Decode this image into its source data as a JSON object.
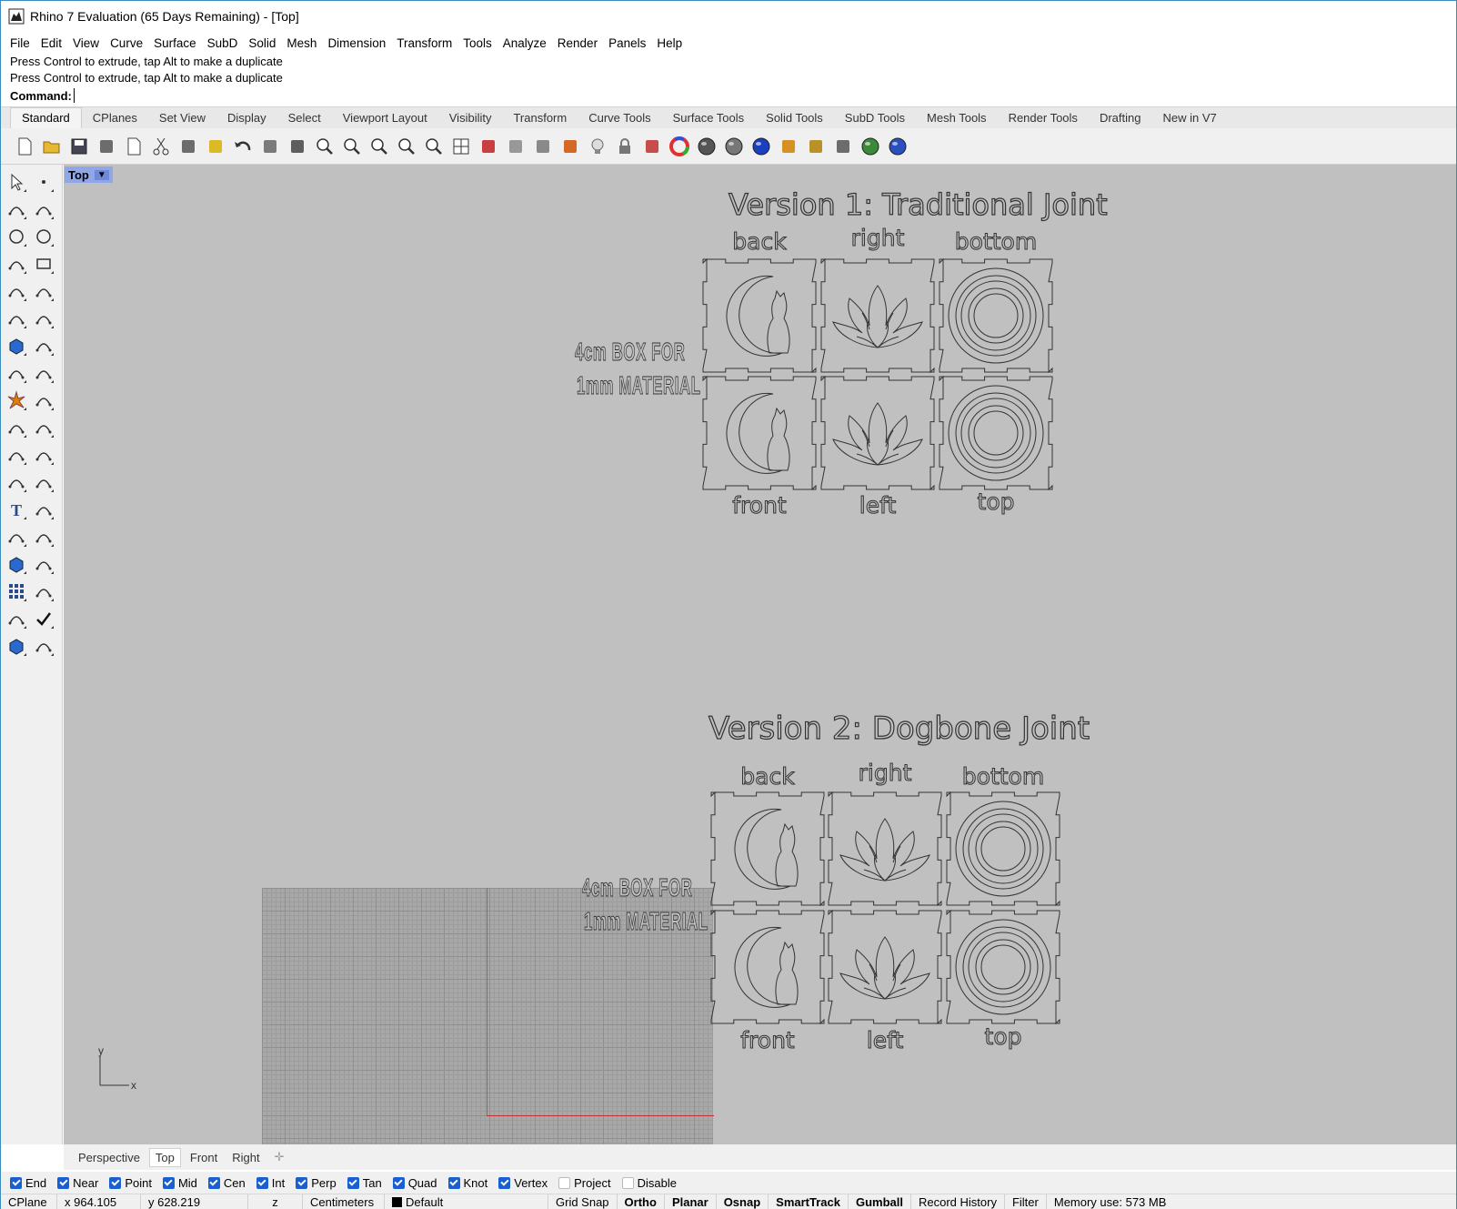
{
  "window": {
    "title": "Rhino 7 Evaluation (65 Days Remaining) - [Top]"
  },
  "menu": [
    "File",
    "Edit",
    "View",
    "Curve",
    "Surface",
    "SubD",
    "Solid",
    "Mesh",
    "Dimension",
    "Transform",
    "Tools",
    "Analyze",
    "Render",
    "Panels",
    "Help"
  ],
  "command": {
    "history": [
      "Press Control to extrude, tap Alt to make a duplicate",
      "Press Control to extrude, tap Alt to make a duplicate"
    ],
    "prompt": "Command:",
    "value": ""
  },
  "toolbar_tabs": [
    "Standard",
    "CPlanes",
    "Set View",
    "Display",
    "Select",
    "Viewport Layout",
    "Visibility",
    "Transform",
    "Curve Tools",
    "Surface Tools",
    "Solid Tools",
    "SubD Tools",
    "Mesh Tools",
    "Render Tools",
    "Drafting",
    "New in V7"
  ],
  "toolbar_icons": [
    "new-icon",
    "open-icon",
    "save-icon",
    "print-icon",
    "import-icon",
    "cut-icon",
    "copy-icon",
    "paste-icon",
    "undo-icon",
    "pan-icon",
    "rotate-view-icon",
    "zoom-icon",
    "zoom-window-icon",
    "zoom-extents-icon",
    "zoom-selected-icon",
    "zoom-dynamic-icon",
    "viewport-grid-icon",
    "named-view-icon",
    "cplane-icon",
    "osnap-icon",
    "gumball-icon",
    "light-icon",
    "lock-icon",
    "layer-icon",
    "color-wheel-icon",
    "material-icon",
    "render-preview-icon",
    "render-icon",
    "highlight-icon",
    "settings-icon",
    "options-icon",
    "world-icon",
    "help-icon"
  ],
  "viewport": {
    "name": "Top",
    "version1_title": "Version 1: Traditional Joint",
    "version2_title": "Version 2: Dogbone Joint",
    "panel_labels_top": [
      "back",
      "right",
      "bottom"
    ],
    "panel_labels_bottom": [
      "front",
      "left",
      "top"
    ],
    "box_for_line1": "4cm BOX FOR",
    "box_for_line2": "1mm MATERIAL",
    "axis_y": "y",
    "axis_x": "x"
  },
  "view_tabs": [
    "Perspective",
    "Top",
    "Front",
    "Right"
  ],
  "active_view_tab": "Top",
  "osnaps": [
    {
      "label": "End",
      "on": true
    },
    {
      "label": "Near",
      "on": true
    },
    {
      "label": "Point",
      "on": true
    },
    {
      "label": "Mid",
      "on": true
    },
    {
      "label": "Cen",
      "on": true
    },
    {
      "label": "Int",
      "on": true
    },
    {
      "label": "Perp",
      "on": true
    },
    {
      "label": "Tan",
      "on": true
    },
    {
      "label": "Quad",
      "on": true
    },
    {
      "label": "Knot",
      "on": true
    },
    {
      "label": "Vertex",
      "on": true
    },
    {
      "label": "Project",
      "on": false
    },
    {
      "label": "Disable",
      "on": false
    }
  ],
  "status": {
    "cplane": "CPlane",
    "x": "x 964.105",
    "y": "y 628.219",
    "z": "z",
    "units": "Centimeters",
    "layer": "Default",
    "grid_snap": "Grid Snap",
    "ortho": "Ortho",
    "planar": "Planar",
    "osnap": "Osnap",
    "smarttrack": "SmartTrack",
    "gumball": "Gumball",
    "record_history": "Record History",
    "filter": "Filter",
    "memory": "Memory use: 573 MB"
  },
  "colors": {
    "viewport_bg": "#c0c0c0",
    "viewport_label": "#8fa6e8",
    "checkbox_on": "#1a5fd0",
    "axis_x": "#c03030",
    "axis_y": "#3a9a3a"
  }
}
